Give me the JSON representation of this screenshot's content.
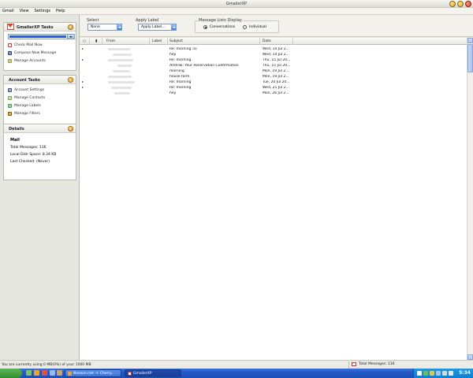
{
  "window": {
    "title": "GmailerXP"
  },
  "menu": [
    "Gmail",
    "View",
    "Settings",
    "Help"
  ],
  "tasks_panel": {
    "title": "GmailerXP Tasks",
    "items": [
      {
        "label": "Check Mail Now",
        "icon": "mail-icon"
      },
      {
        "label": "Compose New Message",
        "icon": "compose-icon"
      },
      {
        "label": "Manage Accounts",
        "icon": "accounts-icon"
      }
    ]
  },
  "account_panel": {
    "title": "Account Tasks",
    "items": [
      {
        "label": "Account Settings",
        "icon": "settings-icon"
      },
      {
        "label": "Manage Contacts",
        "icon": "contacts-icon"
      },
      {
        "label": "Manage Labels",
        "icon": "labels-icon"
      },
      {
        "label": "Manage Filters",
        "icon": "filters-icon"
      }
    ]
  },
  "details_panel": {
    "title": "Details",
    "heading": "Mail",
    "total": "Total Messages: 116",
    "disk": "Local Disk Space: 8.34 KB",
    "checked": "Last Checked: (Never)"
  },
  "toolbar": {
    "select": {
      "label": "Select",
      "value": "None"
    },
    "apply": {
      "label": "Apply Label",
      "value": "Apply Label..."
    },
    "display": {
      "label": "Message Lists Display",
      "options": [
        "Conversations",
        "Individual"
      ],
      "selected": "Conversations"
    }
  },
  "columns": [
    "From",
    "Label",
    "Subject",
    "Date"
  ],
  "messages": [
    {
      "subject": "Re: morning :o)",
      "date": "Wed, 14 Jul 2..."
    },
    {
      "subject": "hey",
      "date": "Wed, 14 Jul 2..."
    },
    {
      "subject": "Re: morning",
      "date": "Thu, 15 Jul 20..."
    },
    {
      "subject": "Amtrak: Your Reservation Confirmation",
      "date": "Thu, 15 Jul 20..."
    },
    {
      "subject": "morning",
      "date": "Mon, 19 Jul 2..."
    },
    {
      "subject": "house form",
      "date": "Mon, 19 Jul 2..."
    },
    {
      "subject": "Re: morning",
      "date": "Tue, 20 Jul 20..."
    },
    {
      "subject": "Re: morning",
      "date": "Wed, 21 Jul 2..."
    },
    {
      "subject": "hey",
      "date": "Mon, 26 Jul 2..."
    }
  ],
  "status": {
    "usage": "You are currently using 0 MB(0%) of your 1000 MB",
    "total": "Total Messages: 116"
  },
  "taskbar": {
    "tasks": [
      "Neowin.net -> Cherry...",
      "GmailerXP"
    ],
    "clock": "5:34"
  }
}
